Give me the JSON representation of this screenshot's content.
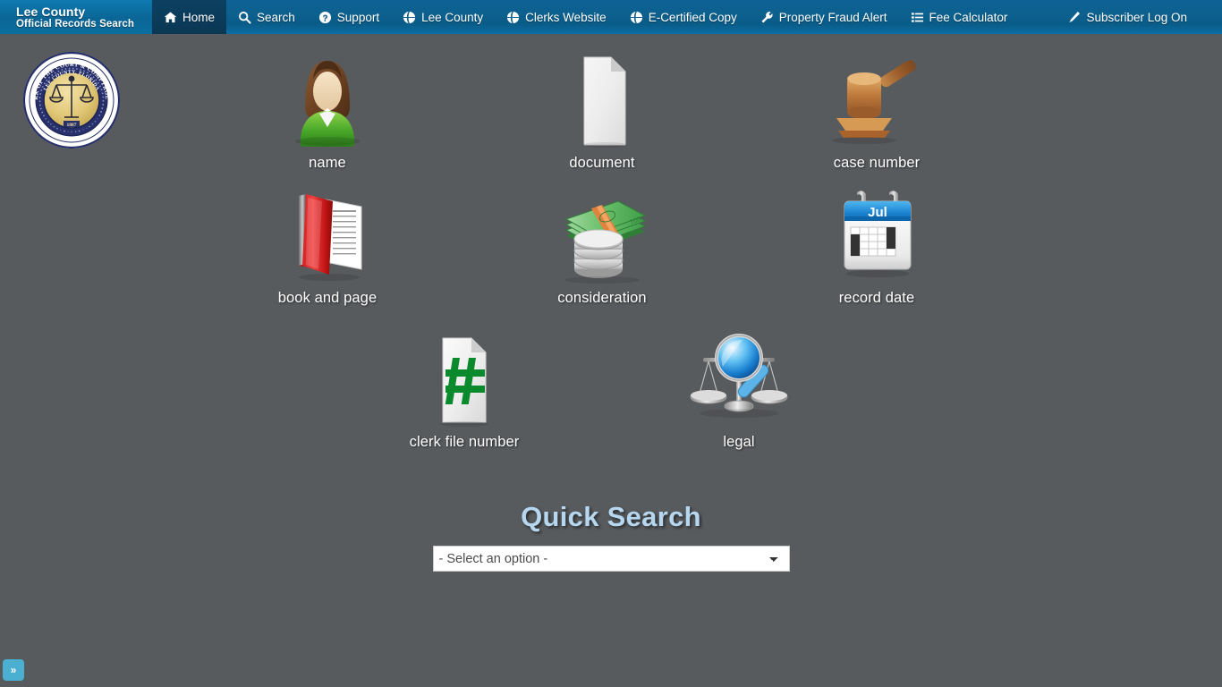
{
  "brand": {
    "line1": "Lee County",
    "line2": "Official Records Search"
  },
  "nav": {
    "items": [
      {
        "label": "Home",
        "icon": "home-icon",
        "active": true
      },
      {
        "label": "Search",
        "icon": "search-icon",
        "active": false
      },
      {
        "label": "Support",
        "icon": "question-circle-icon",
        "active": false
      },
      {
        "label": "Lee County",
        "icon": "globe-icon",
        "active": false
      },
      {
        "label": "Clerks Website",
        "icon": "globe-icon",
        "active": false
      },
      {
        "label": "E-Certified Copy",
        "icon": "globe-icon",
        "active": false
      },
      {
        "label": "Property Fraud Alert",
        "icon": "wrench-icon",
        "active": false
      },
      {
        "label": "Fee Calculator",
        "icon": "list-icon",
        "active": false
      }
    ],
    "right": [
      {
        "label": "Subscriber Log On",
        "icon": "pencil-icon"
      }
    ]
  },
  "seal": {
    "outer_text_top": "CLERK OF THE COURT & COMPTROLLER",
    "inner_text_top": "LEE COUNTY, FLORIDA",
    "year": "1887",
    "motto": "IN GOD WE TRUST"
  },
  "tiles": [
    {
      "label": "name",
      "icon": "person-icon"
    },
    {
      "label": "document",
      "icon": "document-icon"
    },
    {
      "label": "case number",
      "icon": "gavel-icon"
    },
    {
      "label": "book and page",
      "icon": "red-book-icon"
    },
    {
      "label": "consideration",
      "icon": "money-coins-icon"
    },
    {
      "label": "record date",
      "icon": "calendar-icon"
    },
    {
      "label": "clerk file number",
      "icon": "hash-document-icon"
    },
    {
      "label": "legal",
      "icon": "scales-magnifier-icon"
    }
  ],
  "calendar": {
    "month": "Jul"
  },
  "quick_search": {
    "title": "Quick Search",
    "select_value": "- Select an option -",
    "options": [
      "- Select an option -"
    ]
  },
  "corner_toggle": {
    "label": "»"
  },
  "colors": {
    "nav_blue": "#0c618f",
    "nav_active": "#0b3c5d",
    "page_bg": "#585b5e",
    "title_blue": "#b6d7ef",
    "toggle_blue": "#4aafd0"
  }
}
